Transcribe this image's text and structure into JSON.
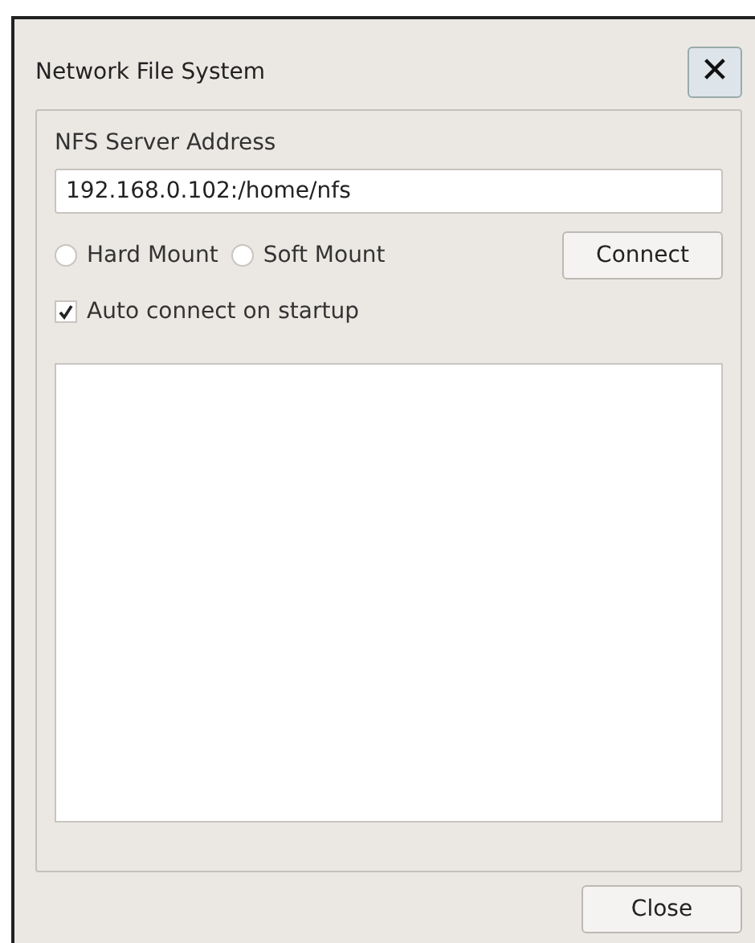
{
  "window": {
    "title": "Network File System",
    "close_glyph": "✕"
  },
  "group": {
    "label": "NFS Server Address",
    "address": "192.168.0.102:/home/nfs",
    "mount_options": [
      {
        "label": "Hard Mount",
        "selected": false
      },
      {
        "label": "Soft Mount",
        "selected": false
      }
    ],
    "connect_button": "Connect",
    "auto_connect": {
      "label": "Auto connect on startup",
      "checked": true
    }
  },
  "buttons": [
    "Close"
  ]
}
